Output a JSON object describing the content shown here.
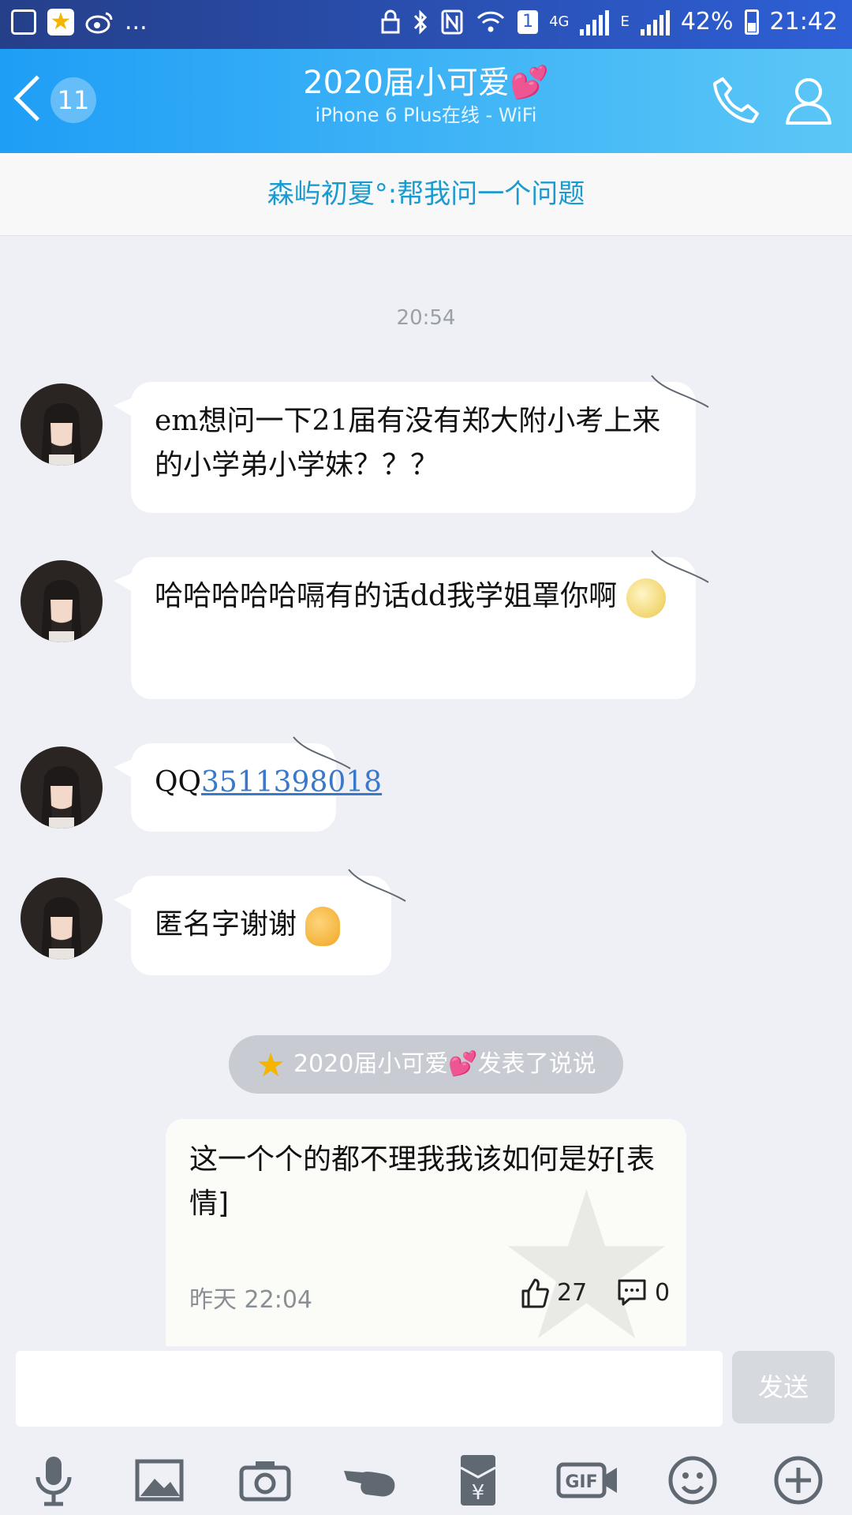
{
  "status_bar": {
    "network_4g": "4G",
    "network_e": "E",
    "sim_index": "1",
    "battery": "42%",
    "time": "21:42",
    "more": "..."
  },
  "header": {
    "unread_count": "11",
    "title": "2020届小可爱💕",
    "subtitle": "iPhone 6 Plus在线 - WiFi"
  },
  "pinned_notice": "森屿初夏°:帮我问一个问题",
  "chat": {
    "timestamp": "20:54",
    "messages": [
      {
        "text": "em想问一下21届有没有郑大附小考上来的小学弟小学妹？？？"
      },
      {
        "text": "哈哈哈哈哈嗝有的话dd我学姐罩你啊"
      },
      {
        "prefix": "QQ",
        "link": "3511398018"
      },
      {
        "text": "匿名字谢谢"
      }
    ]
  },
  "qzone_notice": "2020届小可爱💕发表了说说",
  "post": {
    "text": "这一个个的都不理我我该如何是好[表情]",
    "date": "昨天 22:04",
    "likes": "27",
    "comments": "0"
  },
  "input": {
    "value": "",
    "send_label": "发送"
  },
  "toolbar": {
    "icons": [
      "microphone-icon",
      "image-icon",
      "camera-icon",
      "poke-icon",
      "red-packet-icon",
      "gif-icon",
      "emoji-icon",
      "plus-icon"
    ],
    "gif_label": "GIF",
    "yuan_label": "¥"
  },
  "colors": {
    "header_start": "#1f9ef6",
    "header_end": "#5bc7f6",
    "link": "#3a78c9",
    "pinned_text": "#1a9bd0"
  }
}
